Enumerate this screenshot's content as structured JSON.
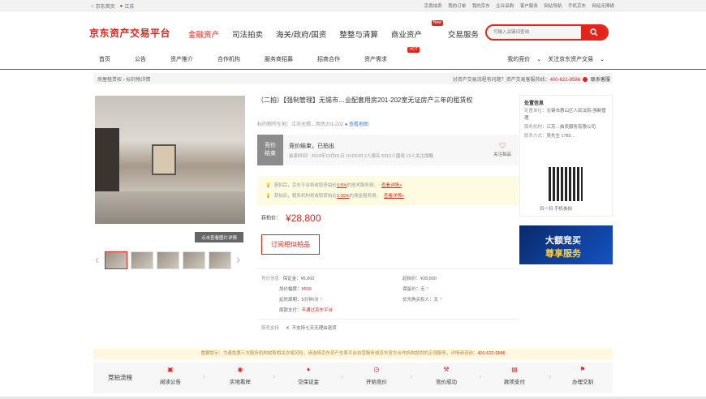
{
  "topbar": {
    "home": "京东首页",
    "location": "江苏",
    "links": [
      "京喜拍卖",
      "我的订单",
      "我的京东",
      "企业采购",
      "客户服务",
      "网站导航",
      "手机京东",
      "网站无障碍"
    ]
  },
  "logo": "京东资产交易平台",
  "main_nav": {
    "items": [
      {
        "label": "金融资产",
        "active": true
      },
      {
        "label": "司法拍卖"
      },
      {
        "label": "海关/政府/国资"
      },
      {
        "label": "整整与清算"
      },
      {
        "label": "商业资产",
        "badge": "New"
      },
      {
        "label": "交易服务"
      }
    ]
  },
  "search": {
    "placeholder": "可输入关键词查询"
  },
  "sub_nav": {
    "items": [
      "首页",
      "公告",
      "资产推介",
      "合作机构",
      "服务商招募",
      "招商合作",
      "资产需求"
    ],
    "hot_badge": "HOT",
    "right": [
      "我的竞价",
      "关注京东资产交易"
    ]
  },
  "breadcrumb": {
    "root": "房屋租赁权",
    "current": "标的物详情"
  },
  "help": {
    "text": "对资产交易流程有问题？资产交易客服热线：",
    "phone": "400-622-9586",
    "service": "联系客服"
  },
  "image": {
    "view_detail": "点击查看图片详情"
  },
  "title": "（二拍）【强制管理】无锡市…业配套用房201-202室无证房产三年的租赁权",
  "address": {
    "label": "标的物所在地：",
    "value": "江苏无锡…用房201-202",
    "map": "查看地图"
  },
  "status": {
    "tag": "竞价结束",
    "title": "竞价结束，已拍出",
    "info": "结束时间：2024年12月01日 10:00:00  2人报名  5910人围观  12人关注提醒",
    "follow": "关注拍品"
  },
  "tips": [
    {
      "text": "获拍后，京东平台将收取获拍价",
      "rate": "1.5%",
      "tail": "的技术服务费。",
      "link": "查看详情>"
    },
    {
      "text": "获拍后，服务机构将收取获拍价",
      "rate": "2.00%",
      "tail": "的佣金服务费。",
      "link": "查看详情>"
    }
  ],
  "price": {
    "label": "获拍价：",
    "value": "¥28,800"
  },
  "subscribe_button": "订阅相似拍品",
  "bid_info": {
    "section": "竞价信息",
    "left": [
      {
        "label": "保证金：",
        "value": "¥5,800"
      },
      {
        "label": "加价幅度：",
        "value": "¥500"
      },
      {
        "label": "延时周期：",
        "value": "5分钟/次"
      },
      {
        "label": "尾款支付：",
        "value": "不通过京东平台"
      }
    ],
    "right": [
      {
        "label": "起拍价：",
        "value": "¥28,800"
      },
      {
        "label": "保留价：",
        "value": "无"
      },
      {
        "label": "优先购买权人：",
        "value": "无"
      }
    ]
  },
  "service": {
    "label": "服务支持",
    "value": "不支持七天无理由退货"
  },
  "disposer": {
    "title": "处置信息",
    "unit_label": "处置单位：",
    "unit": "无锡市惠山区人民法院-强制管理",
    "agency_label": "服务机构：",
    "agency": "江苏…拍卖服务有限公司",
    "contact_label": "联系方式：",
    "contact": "吴先生 1782…",
    "qr_caption": "扫一扫 手机参拍"
  },
  "banner": {
    "line1": "大额竞买",
    "line2": "尊享服务"
  },
  "notice": {
    "text": "重要提示：为避免第三方服务机构收取相关交易风险，请选择京东资产交易平台自营服务或京东官方合作机构提供的正规服务，详情请咨询：",
    "phone": "400-622-9586"
  },
  "flow": {
    "title": "竞拍流程",
    "steps": [
      "阅读公告",
      "实地看样",
      "交保证金",
      "开始竞价",
      "竞价成功",
      "款项支付",
      "办理交割"
    ]
  }
}
